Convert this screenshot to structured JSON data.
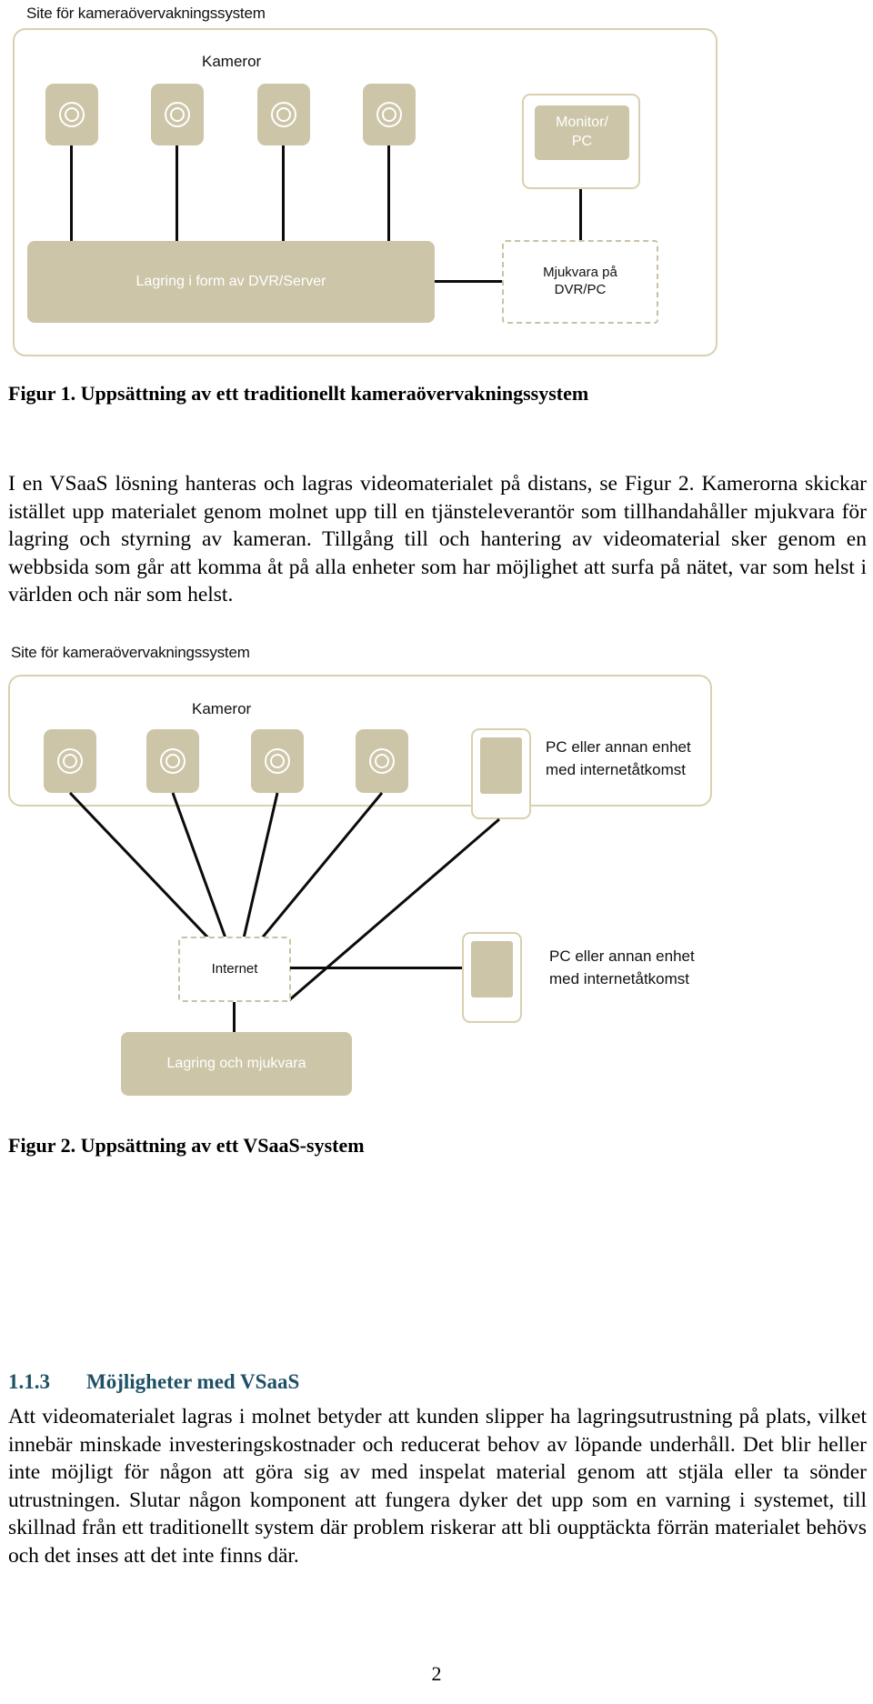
{
  "figure1": {
    "site_label": "Site för kameraövervakningssystem",
    "cameras_label": "Kameror",
    "cameras": [
      {
        "name": "camera-1"
      },
      {
        "name": "camera-2"
      },
      {
        "name": "camera-3"
      },
      {
        "name": "camera-4"
      }
    ],
    "monitor_label": "Monitor/\nPC",
    "monitor_line1": "Monitor/",
    "monitor_line2": "PC",
    "storage_label": "Lagring i form av DVR/Server",
    "software_line1": "Mjukvara på",
    "software_line2": "DVR/PC",
    "caption": "Figur 1. Uppsättning av ett traditionellt kameraövervakningssystem"
  },
  "paragraph1": "I en VSaaS lösning hanteras och lagras videomaterialet på distans, se Figur 2. Kamerorna skickar istället upp materialet genom molnet upp till en tjänsteleverantör som tillhandahåller mjukvara för lagring och styrning av kameran. Tillgång till och hantering av videomaterial sker genom en webbsida som går att komma åt på alla enheter som har möjlighet att surfa på nätet, var som helst i världen och när som helst.",
  "figure2": {
    "site_label": "Site för kameraövervakningssystem",
    "cameras_label": "Kameror",
    "cameras": [
      {
        "name": "camera-1"
      },
      {
        "name": "camera-2"
      },
      {
        "name": "camera-3"
      },
      {
        "name": "camera-4"
      }
    ],
    "device_top_line1": "PC eller annan enhet",
    "device_top_line2": "med internetåtkomst",
    "internet_label": "Internet",
    "device_bottom_line1": "PC eller annan enhet",
    "device_bottom_line2": "med internetåtkomst",
    "storage_label": "Lagring och mjukvara",
    "caption": "Figur 2. Uppsättning av ett VSaaS-system"
  },
  "section": {
    "number": "1.1.3",
    "title": "Möjligheter med VSaaS"
  },
  "paragraph2": "Att videomaterialet lagras i molnet betyder att kunden slipper ha lagringsutrustning på plats, vilket innebär minskade investeringskostnader och reducerat behov av löpande underhåll. Det blir heller inte möjligt för någon att göra sig av med inspelat material genom att stjäla eller ta sönder utrustningen. Slutar någon komponent att fungera dyker det upp som en varning i systemet, till skillnad från ett traditionellt system där problem riskerar att bli oupptäckta förrän materialet behövs och det inses att det inte finns där.",
  "page_number": "2",
  "colors": {
    "tan_fill": "#ccc5a8",
    "tan_border": "#d8d0b0",
    "dashed_border": "#c9c2a4",
    "wire": "#0b0b0b",
    "heading": "#1f5166"
  }
}
